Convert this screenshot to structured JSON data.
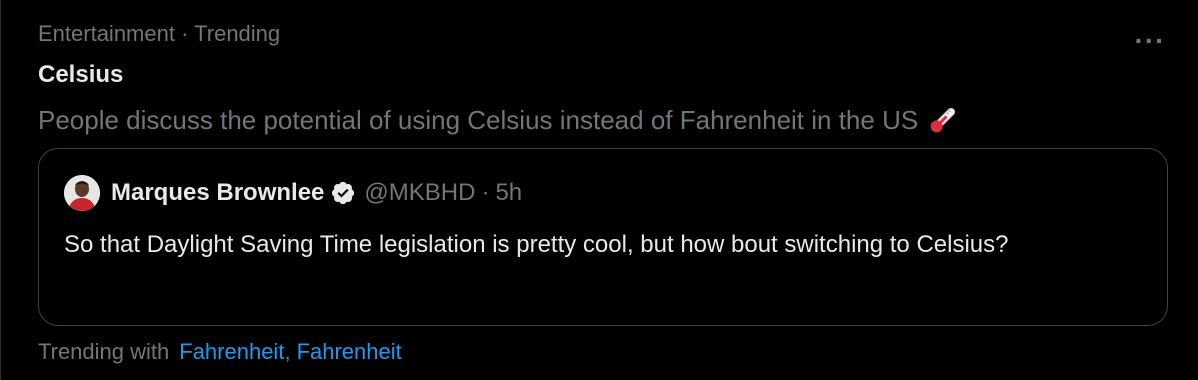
{
  "trend": {
    "category": "Entertainment",
    "separator": "·",
    "status": "Trending",
    "title": "Celsius",
    "description": "People discuss the potential of using Celsius instead of Fahrenheit in the US",
    "description_emoji": "thermometer-icon",
    "more_label": "···"
  },
  "quote_tweet": {
    "author_name": "Marques Brownlee",
    "verified_icon": "verified-badge-icon",
    "handle": "@MKBHD",
    "separator": "·",
    "time": "5h",
    "text": "So that Daylight Saving Time legislation is pretty cool, but how bout switching to Celsius?"
  },
  "footer": {
    "label": "Trending with",
    "links": [
      "Fahrenheit",
      "Fahrenheit"
    ],
    "link_separator": ","
  },
  "colors": {
    "background": "#000000",
    "primary_text": "#e7e9ea",
    "secondary_text": "#71767b",
    "link": "#1d9bf0",
    "border": "#3e4144"
  }
}
